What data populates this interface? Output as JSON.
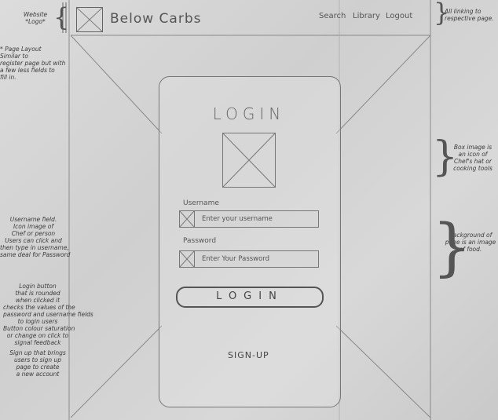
{
  "header": {
    "website_logo_note": "Website\n*Logo*",
    "brand": "Below Carbs",
    "nav": [
      "Search",
      "Library",
      "Logout"
    ],
    "nav_note": "All linking to\nrespective page."
  },
  "login": {
    "title": "LOGIN",
    "username_label": "Username",
    "username_placeholder": "Enter your username",
    "password_label": "Password",
    "password_placeholder": "Enter Your Password",
    "button_label": "LOGIN",
    "signup_label": "SIGN-UP"
  },
  "notes": {
    "page_layout": "* Page Layout\nSimilar to\nregister page but with\na few less fields to\nfill in.",
    "username_field": "Username field.\nIcon image of\nChef or person\nUsers can click and\nthen type in username,\nsame deal for Password",
    "login_button": "Login button\nthat is rounded\nwhen clicked it\nchecks the values of the\npassword and username fields\nto login users\nButton colour saturation\nor change on click to\nsignal feedback",
    "signup": "Sign up that brings\nusers to sign up\npage to create\na new account",
    "box_image": "Box image is\nan icon of\nChef's hat or\ncooking tools",
    "background": "Background of\npage is an image\nof food."
  },
  "icons": {
    "logo": "placeholder-image-icon",
    "hat": "chef-hat-image",
    "user": "user-icon",
    "lock": "password-icon"
  }
}
